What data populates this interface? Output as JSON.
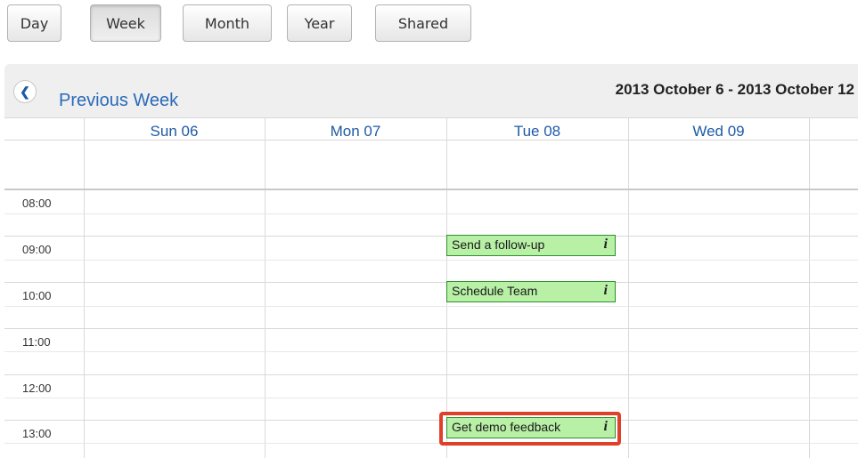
{
  "views": {
    "buttons": [
      {
        "label": "Day"
      },
      {
        "label": "Week",
        "active": true
      },
      {
        "label": "Month"
      },
      {
        "label": "Year"
      },
      {
        "label": "Shared"
      }
    ]
  },
  "header": {
    "prev_label": "Previous Week",
    "range_title": "2013 October 6 - 2013 October 12"
  },
  "days": [
    "Sun 06",
    "Mon 07",
    "Tue 08",
    "Wed 09"
  ],
  "times": [
    "08:00",
    "09:00",
    "10:00",
    "11:00",
    "12:00",
    "13:00"
  ],
  "events": [
    {
      "title": "Send a follow-up",
      "day": "Tue 08",
      "time": "09:00",
      "info": "i",
      "highlighted": false
    },
    {
      "title": "Schedule Team",
      "day": "Tue 08",
      "time": "10:00",
      "info": "i",
      "highlighted": false
    },
    {
      "title": "Get demo feedback",
      "day": "Tue 08",
      "time": "13:00",
      "info": "i",
      "highlighted": true
    }
  ],
  "colors": {
    "event_bg": "#b8f0a6",
    "event_border": "#2f8f2f",
    "highlight": "#e0402a",
    "link": "#2a6ab8"
  }
}
